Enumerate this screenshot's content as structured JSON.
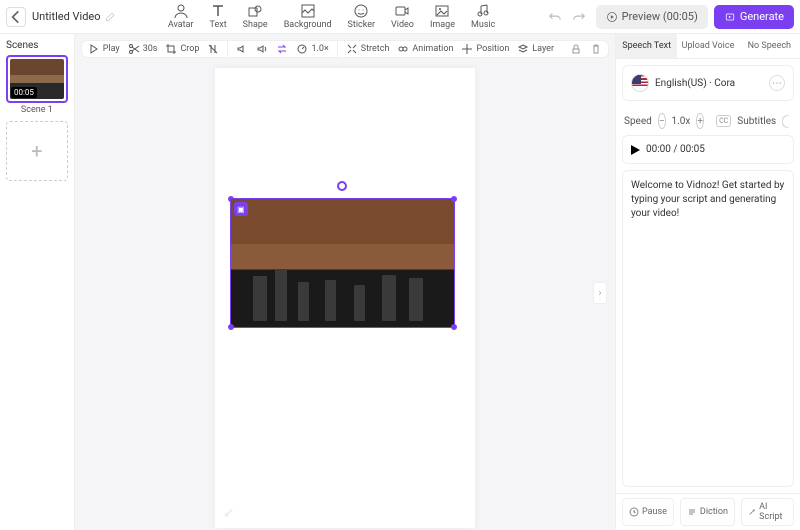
{
  "header": {
    "title": "Untitled Video",
    "tools": [
      {
        "id": "avatar",
        "label": "Avatar"
      },
      {
        "id": "text",
        "label": "Text"
      },
      {
        "id": "shape",
        "label": "Shape"
      },
      {
        "id": "background",
        "label": "Background"
      },
      {
        "id": "sticker",
        "label": "Sticker"
      },
      {
        "id": "video",
        "label": "Video"
      },
      {
        "id": "image",
        "label": "Image"
      },
      {
        "id": "music",
        "label": "Music"
      }
    ],
    "preview_label": "Preview (00:05)",
    "generate_label": "Generate"
  },
  "scenes": {
    "heading": "Scenes",
    "duration": "00:05",
    "scene_name": "Scene 1"
  },
  "canvas_toolbar": {
    "play": "Play",
    "trim": "30s",
    "crop": "Crop",
    "speed": "1.0×",
    "stretch": "Stretch",
    "animation": "Animation",
    "position": "Position",
    "layer": "Layer"
  },
  "right": {
    "tabs": {
      "speech": "Speech Text",
      "upload": "Upload Voice",
      "none": "No Speech"
    },
    "voice": {
      "label": "English(US) · Cora"
    },
    "speed": {
      "label": "Speed",
      "value": "1.0x",
      "subtitles": "Subtitles",
      "cc": "CC"
    },
    "time": "00:00 / 00:05",
    "script": "Welcome to Vidnoz! Get started by typing your script and generating your video!",
    "bottom": {
      "pause": "Pause",
      "diction": "Diction",
      "ai": "AI Script"
    }
  }
}
